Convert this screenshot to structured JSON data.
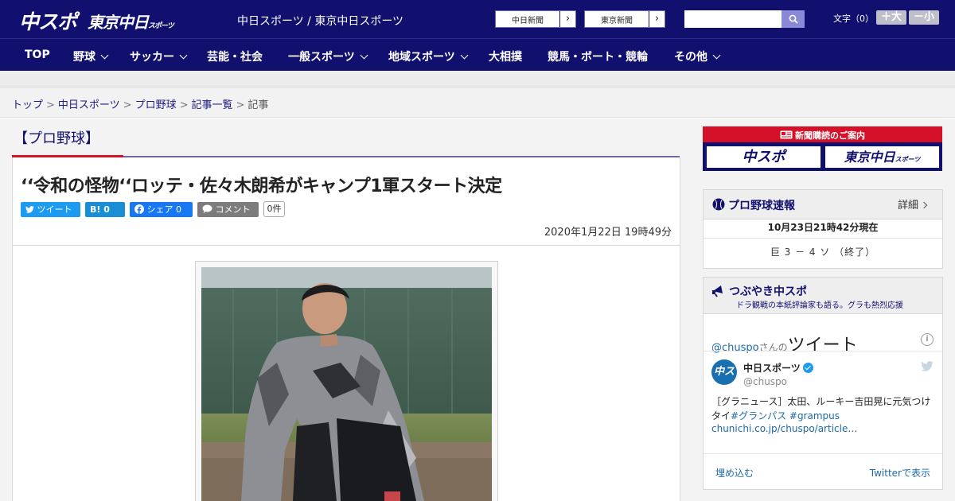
{
  "header": {
    "logo_main": "中スポ",
    "logo_tokyo": "東京中日",
    "logo_tokyo_small": "スポーツ",
    "site_title": "中日スポーツ / 東京中日スポーツ",
    "ext_links": [
      "中日新聞",
      "東京新聞"
    ],
    "search_placeholder": "",
    "font_label": "文字（0）",
    "font_larger": "＋大",
    "font_smaller": "－小"
  },
  "nav": {
    "items": [
      {
        "label": "TOP",
        "has_menu": false
      },
      {
        "label": "野球",
        "has_menu": true
      },
      {
        "label": "サッカー",
        "has_menu": true
      },
      {
        "label": "芸能・社会",
        "has_menu": false
      },
      {
        "label": "一般スポーツ",
        "has_menu": true
      },
      {
        "label": "地域スポーツ",
        "has_menu": true
      },
      {
        "label": "大相撲",
        "has_menu": false
      },
      {
        "label": "競馬・ボート・競輪",
        "has_menu": false
      },
      {
        "label": "その他",
        "has_menu": true
      }
    ]
  },
  "breadcrumb": {
    "items": [
      "トップ",
      "中日スポーツ",
      "プロ野球",
      "記事一覧"
    ],
    "current": "記事"
  },
  "article": {
    "category": "【プロ野球】",
    "headline": "‘‘令和の怪物‘‘ロッテ・佐々木朗希がキャンプ1軍スタート決定",
    "share": {
      "tweet": "ツイート",
      "hatena": "B! 0",
      "facebook": "シェア 0",
      "comment": "コメント",
      "comment_count": "0件"
    },
    "date": "2020年1月22日 19時49分"
  },
  "sidebar": {
    "banner": {
      "title": "新聞購読のご案内",
      "left": "中スポ",
      "right": "東京中日",
      "right_small": "スポーツ"
    },
    "baseball": {
      "title": "プロ野球速報",
      "detail": "詳細",
      "time": "10月23日21時42分現在",
      "score": "巨 3 － 4 ソ （終了）"
    },
    "tweets": {
      "title": "つぶやき中スポ",
      "subtitle": "ドラ観戦の本紙評論家も語る。グラも熱烈応援",
      "handle": "@chuspo",
      "handle_suffix": "さんの",
      "handle_big": "ツイート",
      "info": "i",
      "avatar": "中スポ",
      "name": "中日スポーツ",
      "id": "@chuspo",
      "text": "［グラニュース］太田、ルーキー吉田晃に元気つけ",
      "text2": "タイ",
      "tags": "#グランパス #grampus",
      "link": "chunichi.co.jp/chuspo/article…",
      "embed": "埋め込む",
      "view": "Twitterで表示"
    }
  },
  "colors": {
    "brand_navy": "#12106e",
    "accent_red": "#d2142a",
    "twitter_blue": "#1d9bf0"
  }
}
